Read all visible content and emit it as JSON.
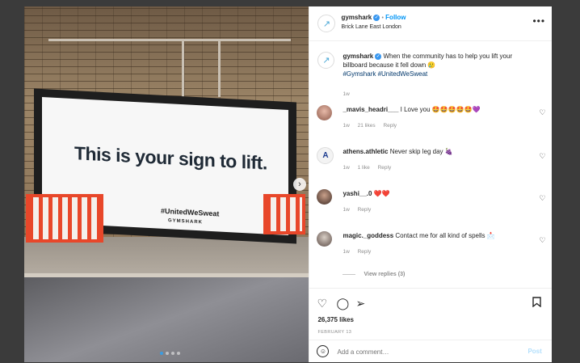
{
  "post": {
    "billboard_headline": "This is your sign to lift.",
    "billboard_hashtag": "#UnitedWeSweat",
    "billboard_logo": "GYMSHARK"
  },
  "header": {
    "username": "gymshark",
    "separator": "•",
    "follow_label": "Follow",
    "location": "Brick Lane East London",
    "more_icon": "more-horizontal-icon"
  },
  "caption": {
    "username": "gymshark",
    "text": "When the community has to help you lift your billboard because it fell down 🥲",
    "hashtags": "#Gymshark #UnitedWeSweat",
    "time": "1w"
  },
  "comments": [
    {
      "username": "_mavis_headri___",
      "text": "I Love you 🤩🤩🤩🤩🤩💜",
      "time": "1w",
      "likes": "21 likes",
      "reply": "Reply"
    },
    {
      "username": "athens.athletic",
      "text": "Never skip leg day 🍇",
      "time": "1w",
      "likes": "1 like",
      "reply": "Reply"
    },
    {
      "username": "yashi__.0",
      "text": "❤️❤️",
      "time": "1w",
      "likes": "",
      "reply": "Reply"
    },
    {
      "username": "magic._goddess",
      "text": "Contact me for all kind of spells 📩",
      "time": "1w",
      "likes": "",
      "reply": "Reply"
    }
  ],
  "view_replies": "View replies (3)",
  "likes_count": "26,375 likes",
  "post_date": "FEBRUARY 13",
  "add_comment": {
    "placeholder": "Add a comment…",
    "post_label": "Post"
  },
  "colors": {
    "accent": "#0095f6",
    "barrier": "#e8472a"
  }
}
